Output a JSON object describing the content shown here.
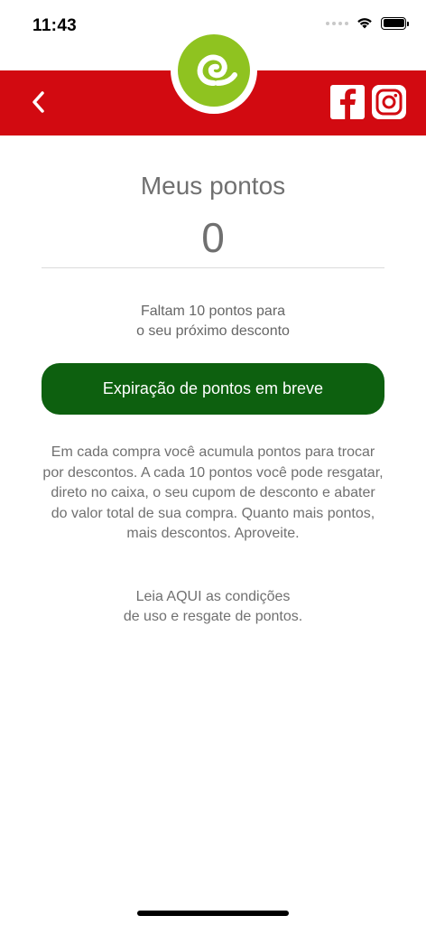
{
  "status_bar": {
    "time": "11:43"
  },
  "header": {
    "back_icon": "chevron-left-icon",
    "logo": "brand-logo",
    "social": [
      "facebook-icon",
      "instagram-icon"
    ],
    "colors": {
      "bar": "#d20a11",
      "logo": "#8fc320"
    }
  },
  "main": {
    "title": "Meus pontos",
    "points": "0",
    "remaining_line1": "Faltam 10 pontos para",
    "remaining_line2": "o seu próximo desconto",
    "expire_button": "Expiração de pontos em breve",
    "info_text": "Em cada compra você acumula pontos para trocar por descontos. A cada 10 pontos você pode resgatar, direto no caixa, o seu cupom de desconto e abater do valor total de sua compra. Quanto mais pontos, mais descontos. Aproveite.",
    "conditions_line1": "Leia AQUI as condições",
    "conditions_line2": "de uso e resgate de pontos.",
    "colors": {
      "button": "#0d600f"
    }
  }
}
